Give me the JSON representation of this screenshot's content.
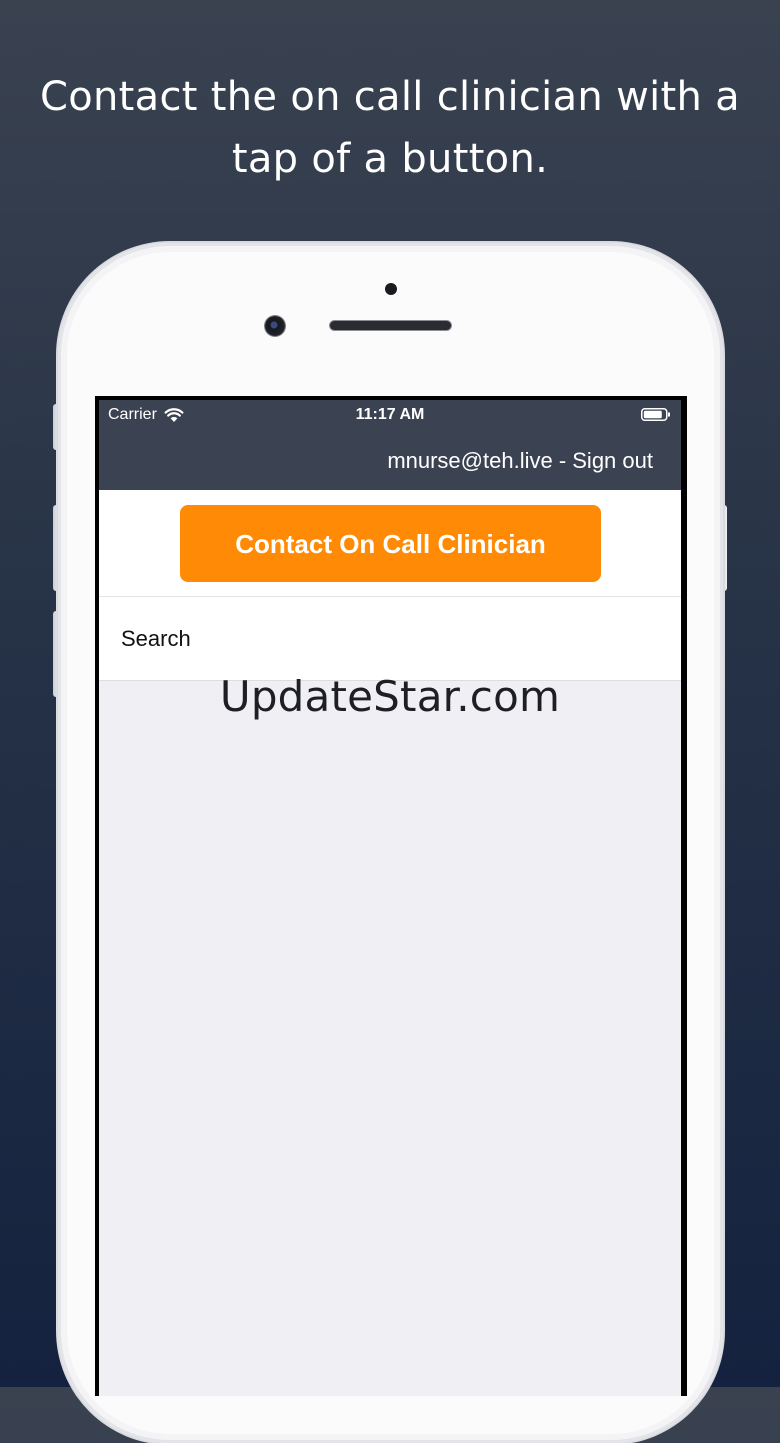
{
  "promo": {
    "headline_line1": "Contact the on call clinician with a",
    "headline_line2": "tap of a button."
  },
  "status_bar": {
    "carrier": "Carrier",
    "time": "11:17 AM",
    "wifi_icon": "wifi-icon",
    "battery_icon": "battery-icon"
  },
  "nav": {
    "account_text": "mnurse@teh.live - Sign out"
  },
  "main": {
    "contact_button_label": "Contact On Call Clinician",
    "search_placeholder": "Search"
  },
  "watermark": "UpdateStar.com",
  "colors": {
    "background_top": "#3a4250",
    "background_bottom": "#14223f",
    "nav_bar": "#3b4251",
    "accent_orange": "#ff8a05",
    "list_background": "#efeff4"
  }
}
